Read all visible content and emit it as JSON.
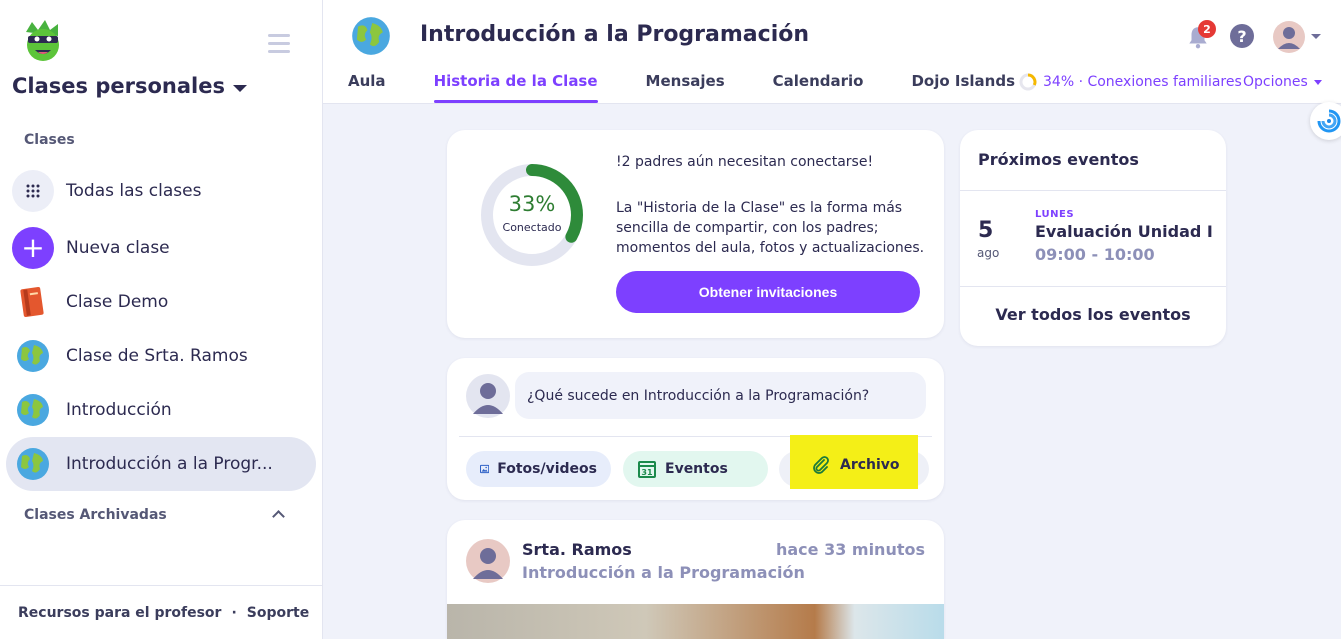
{
  "sidebar": {
    "school_title": "Clases personales",
    "classes_label": "Clases",
    "items": [
      {
        "label": "Todas las clases"
      },
      {
        "label": "Nueva clase"
      },
      {
        "label": "Clase Demo"
      },
      {
        "label": "Clase de Srta. Ramos"
      },
      {
        "label": "Introducción"
      },
      {
        "label": "Introducción a la Progr..."
      }
    ],
    "archived_label": "Clases Archivadas",
    "footer": {
      "resources": "Recursos para el profesor",
      "separator": "·",
      "support": "Soporte"
    }
  },
  "header": {
    "title": "Introducción a la Programación",
    "tabs": [
      "Aula",
      "Historia de la Clase",
      "Mensajes",
      "Calendario",
      "Dojo Islands"
    ],
    "active_tab": "Historia de la Clase",
    "notification_count": "2",
    "help": "?",
    "connections": "34% · Conexiones familiares",
    "options": "Opciones"
  },
  "connection_card": {
    "percent": "33%",
    "percent_label": "Conectado",
    "progress": 0.33,
    "headline": "!2 padres aún necesitan conectarse!",
    "body": "La \"Historia de la Clase\" es la forma más sencilla de compartir, con los padres; momentos del aula, fotos y actualizaciones.",
    "button": "Obtener invitaciones"
  },
  "composer": {
    "placeholder": "¿Qué sucede en Introducción a la Programación?",
    "photos": "Fotos/videos",
    "events": "Eventos",
    "file": "Archivo"
  },
  "post": {
    "author": "Srta. Ramos",
    "class_name": "Introducción a la Programación",
    "time": "hace 33 minutos"
  },
  "events": {
    "title": "Próximos eventos",
    "day": "5",
    "month": "ago",
    "weekday": "LUNES",
    "name": "Evaluación Unidad I",
    "time": "09:00 - 10:00",
    "see_all": "Ver todos los eventos"
  },
  "colors": {
    "accent": "#7d40ff",
    "connected": "#2e8b3a",
    "badge": "#e53935",
    "highlight": "#f4ef17"
  }
}
